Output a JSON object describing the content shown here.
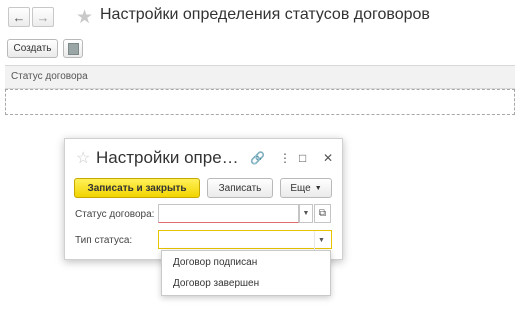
{
  "page": {
    "title": "Настройки определения статусов договоров",
    "back_icon": "arrow-left-icon",
    "forward_icon": "arrow-right-icon",
    "favorite_icon": "star-icon"
  },
  "toolbar": {
    "create_label": "Создать",
    "copy_icon": "copy-icon"
  },
  "list": {
    "columns": [
      "Статус договора"
    ]
  },
  "dialog": {
    "title": "Настройки опре…",
    "buttons": {
      "save_close": "Записать и закрыть",
      "save": "Записать",
      "more": "Еще"
    },
    "fields": {
      "status_label": "Статус договора:",
      "status_value": "",
      "type_label": "Тип статуса:",
      "type_value": ""
    }
  },
  "dropdown": {
    "options": [
      "Договор подписан",
      "Договор завершен"
    ]
  },
  "colors": {
    "accent_yellow": "#f5d800",
    "error_underline": "#e06b6b"
  }
}
